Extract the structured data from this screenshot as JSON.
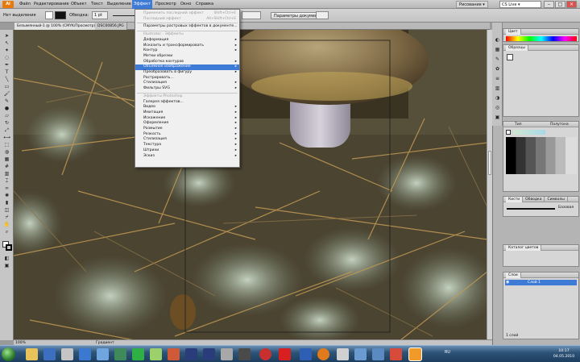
{
  "app": {
    "logo": "Ai"
  },
  "menubar": {
    "items": [
      "Файл",
      "Редактирование",
      "Объект",
      "Текст",
      "Выделение",
      "Эффект",
      "Просмотр",
      "Окно",
      "Справка"
    ],
    "workspace": "Рисование ▾",
    "search": "CS Live ▾"
  },
  "control": {
    "selection": "Нет выделения",
    "stroke_label": "Обводка:",
    "stroke_value": "1 pt",
    "style": "Стиль:",
    "doc_setup": "Параметры документа"
  },
  "tab": {
    "title": "Безымянный-1 @ 100% (CMYK/Просмотр)",
    "second": "DSC00856.JPG"
  },
  "effect_menu": {
    "rows": [
      {
        "label": "Применить последний эффект",
        "shortcut": "Shift+Ctrl+E",
        "state": "disabled",
        "arrow": ""
      },
      {
        "label": "Последний эффект",
        "shortcut": "Alt+Shift+Ctrl+E",
        "state": "disabled",
        "arrow": ""
      },
      {
        "label": "",
        "state": "sep"
      },
      {
        "label": "Параметры растровых эффектов в документе...",
        "state": "normal",
        "arrow": ""
      },
      {
        "label": "",
        "state": "sep"
      },
      {
        "label": "Illustrator - Эффекты",
        "state": "disabled",
        "arrow": ""
      },
      {
        "label": "Деформация",
        "state": "normal",
        "arrow": "▸"
      },
      {
        "label": "Исказить и трансформировать",
        "state": "normal",
        "arrow": "▸"
      },
      {
        "label": "Контур",
        "state": "normal",
        "arrow": "▸"
      },
      {
        "label": "Метки обрезки",
        "state": "normal",
        "arrow": ""
      },
      {
        "label": "Обработка контуров",
        "state": "normal",
        "arrow": "▸"
      },
      {
        "label": "Объемное изображение",
        "state": "highlight",
        "arrow": "▸"
      },
      {
        "label": "Преобразовать в фигуру",
        "state": "normal",
        "arrow": "▸"
      },
      {
        "label": "Растрировать...",
        "state": "normal",
        "arrow": ""
      },
      {
        "label": "Стилизация",
        "state": "normal",
        "arrow": "▸"
      },
      {
        "label": "Фильтры SVG",
        "state": "normal",
        "arrow": "▸"
      },
      {
        "label": "",
        "state": "sep"
      },
      {
        "label": "Эффекты Photoshop",
        "state": "disabled",
        "arrow": ""
      },
      {
        "label": "Галерея эффектов...",
        "state": "normal",
        "arrow": ""
      },
      {
        "label": "Видео",
        "state": "normal",
        "arrow": "▸"
      },
      {
        "label": "Имитация",
        "state": "normal",
        "arrow": "▸"
      },
      {
        "label": "Искажение",
        "state": "normal",
        "arrow": "▸"
      },
      {
        "label": "Оформление",
        "state": "normal",
        "arrow": "▸"
      },
      {
        "label": "Размытие",
        "state": "normal",
        "arrow": "▸"
      },
      {
        "label": "Резкость",
        "state": "normal",
        "arrow": "▸"
      },
      {
        "label": "Стилизация",
        "state": "normal",
        "arrow": "▸"
      },
      {
        "label": "Текстура",
        "state": "normal",
        "arrow": "▸"
      },
      {
        "label": "Штрихи",
        "state": "normal",
        "arrow": "▸"
      },
      {
        "label": "Эскиз",
        "state": "normal",
        "arrow": "▸"
      }
    ]
  },
  "panels": {
    "color_tab": "Цвет",
    "swatches_tab": "Образцы",
    "gradient_labels": [
      "Тип",
      "Полутона"
    ],
    "brushes_tabs": [
      "Кисти",
      "Обводка",
      "Символы"
    ],
    "brush_name": "Базовая",
    "color_guide_tab": "Каталог цветов",
    "layers_tab": "Слои",
    "layer_name": "Слой 1",
    "layer_count": "1 слой"
  },
  "status": {
    "zoom": "100%",
    "tool": "Градиент"
  },
  "clock": {
    "time": "10:17",
    "date": "04.05.2010",
    "lang": "RU"
  },
  "colors": {
    "accent": "#3d7bd6",
    "menu_bg": "#f0f0f0"
  }
}
